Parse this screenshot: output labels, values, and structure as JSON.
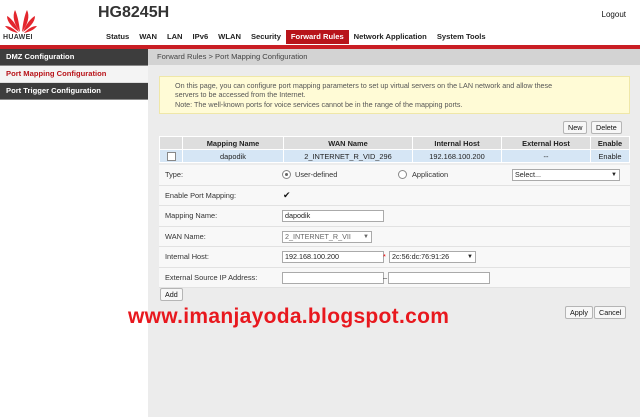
{
  "header": {
    "brand": "HUAWEI",
    "model": "HG8245H",
    "logout_label": "Logout",
    "accent_color": "#c91e24"
  },
  "nav": {
    "items": [
      "Status",
      "WAN",
      "LAN",
      "IPv6",
      "WLAN",
      "Security",
      "Forward Rules",
      "Network Application",
      "System Tools"
    ],
    "active": "Forward Rules"
  },
  "sidebar": {
    "items": [
      "DMZ Configuration",
      "Port Mapping Configuration",
      "Port Trigger Configuration"
    ],
    "active": "Port Mapping Configuration"
  },
  "breadcrumb": "Forward Rules > Port Mapping Configuration",
  "notice": {
    "line1": "On this page, you can configure port mapping parameters to set up virtual servers on the LAN network and allow these",
    "line2": "servers to be accessed from the Internet.",
    "line3": "Note: The well-known ports for voice services cannot be in the range of the mapping ports."
  },
  "toolbar": {
    "new_label": "New",
    "delete_label": "Delete"
  },
  "table": {
    "headers": [
      "Mapping Name",
      "WAN Name",
      "Internal Host",
      "External Host",
      "Enable"
    ],
    "rows": [
      {
        "mapping_name": "dapodik",
        "wan_name": "2_INTERNET_R_VID_296",
        "internal_host": "192.168.100.200",
        "external_host": "--",
        "enable": "Enable"
      }
    ]
  },
  "form": {
    "type_label": "Type:",
    "type_user_defined": "User-defined",
    "type_application": "Application",
    "application_select": "Select...",
    "enable_label": "Enable Port Mapping:",
    "mapping_name_label": "Mapping Name:",
    "mapping_name_value": "dapodik",
    "wan_name_label": "WAN Name:",
    "wan_name_value": "2_INTERNET_R_VII",
    "internal_host_label": "Internal Host:",
    "internal_host_value": "192.168.100.200",
    "required_mark": "*",
    "mac_value": "2c:56:dc:76:91:26",
    "external_ip_label": "External Source IP Address:",
    "range_sep": "–",
    "add_label": "Add"
  },
  "footer": {
    "apply_label": "Apply",
    "cancel_label": "Cancel"
  },
  "watermark": "www.imanjayoda.blogspot.com"
}
